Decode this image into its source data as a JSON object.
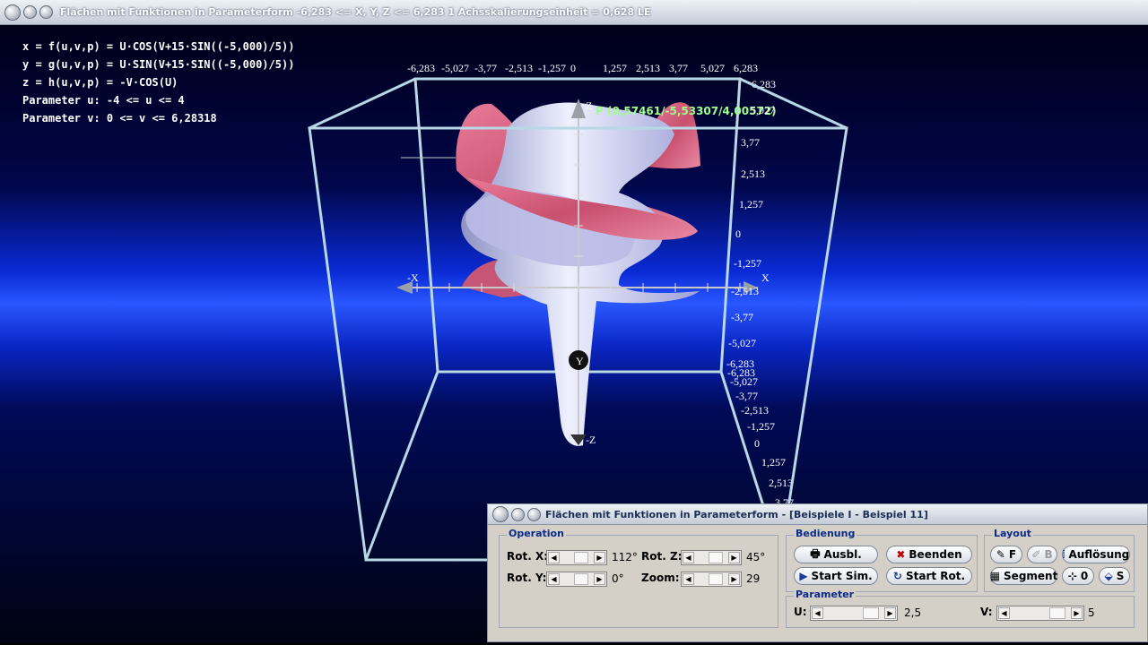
{
  "main_window": {
    "title": "Flächen mit Funktionen in Parameterform   -6,283 <= X, Y, Z <= 6,283    1 Achsskalierungseinheit = 0,628 LE"
  },
  "equations": [
    "x = f(u,v,p) = U·COS(V+15·SIN((-5,000)/5))",
    "y = g(u,v,p) = U·SIN(V+15·SIN((-5,000)/5))",
    "z = h(u,v,p) = -V·COS(U)",
    "Parameter u: -4 <= u <= 4",
    "Parameter v: 0 <= v <= 6,28318"
  ],
  "axes": {
    "top_ticks": [
      "-6,283",
      "-5,027",
      "-3,77",
      "-2,513",
      "-1,257",
      "0",
      "1,257",
      "2,513",
      "3,77",
      "5,027",
      "6,283"
    ],
    "right_upper_ticks": [
      "6,283",
      "5,027",
      "3,77",
      "2,513",
      "1,257",
      "0",
      "-1,257",
      "-2,513",
      "-3,77",
      "-5,027",
      "-6,283"
    ],
    "right_lower_ticks": [
      "-6,283",
      "-5,027",
      "-3,77",
      "-2,513",
      "-1,257",
      "0",
      "1,257",
      "2,513",
      "3,77"
    ],
    "x_label": "X",
    "neg_x_label": "-X",
    "z_label": "Z",
    "neg_z_label": "-Z",
    "y_label": "Y",
    "point_label": "P (0,57461/-5,53307/4,00572)"
  },
  "dialog": {
    "title": "Flächen mit Funktionen in Parameterform - [Beispiele I - Beispiel 11]",
    "operation": {
      "label": "Operation",
      "rot_x_label": "Rot. X:",
      "rot_x_value": "112°",
      "rot_y_label": "Rot. Y:",
      "rot_y_value": "0°",
      "rot_z_label": "Rot. Z:",
      "rot_z_value": "45°",
      "zoom_label": "Zoom:",
      "zoom_value": "29"
    },
    "bedienung": {
      "label": "Bedienung",
      "ausbl": "Ausbl.",
      "beenden": "Beenden",
      "start_sim": "Start Sim.",
      "start_rot": "Start Rot."
    },
    "layout": {
      "label": "Layout",
      "f": "F",
      "b": "B",
      "aufloesung": "Auflösung",
      "segment": "Segment",
      "zero": "0",
      "s": "S"
    },
    "parameter": {
      "label": "Parameter",
      "u_label": "U:",
      "u_value": "2,5",
      "v_label": "V:",
      "v_value": "5"
    }
  },
  "colors": {
    "surface_pink": "#d8607f",
    "surface_lavender": "#c9cbee",
    "cube_edge": "#b8d8e6",
    "point_label": "#9dff8a",
    "group_label": "#0a2a8a"
  }
}
